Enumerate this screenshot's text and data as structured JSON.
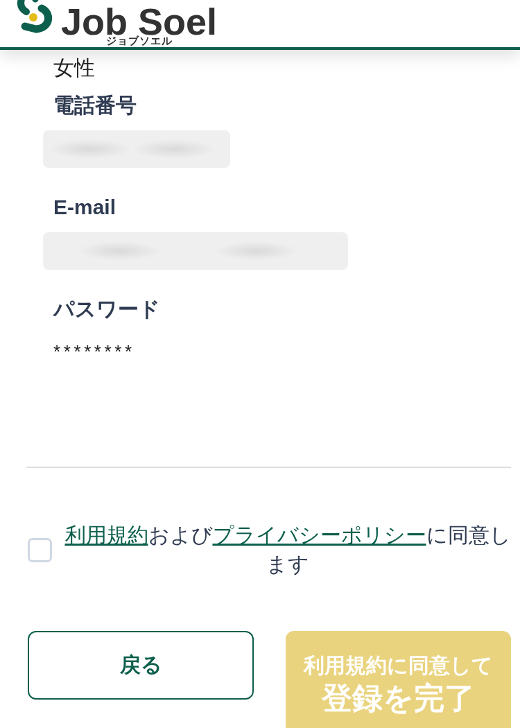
{
  "header": {
    "logo_text": "Job Soel",
    "logo_subtext": "ジョブソエル"
  },
  "fields": [
    {
      "kind": "text",
      "value": "女性"
    },
    {
      "kind": "redacted",
      "label": "電話番号"
    },
    {
      "kind": "redacted",
      "label": "E-mail"
    },
    {
      "kind": "text",
      "label": "パスワード",
      "value": "********"
    }
  ],
  "agreement": {
    "checked": false,
    "parts": [
      {
        "kind": "link",
        "text": "利用規約"
      },
      {
        "kind": "text",
        "text": "および"
      },
      {
        "kind": "link",
        "text": "プライバシーポリシー"
      },
      {
        "kind": "text",
        "text": "に同意します"
      }
    ]
  },
  "buttons": {
    "back": {
      "label": "戻る"
    },
    "submit": {
      "line_1": "利用規約に同意して",
      "line_2": "登録を完了",
      "disabled": true
    }
  }
}
